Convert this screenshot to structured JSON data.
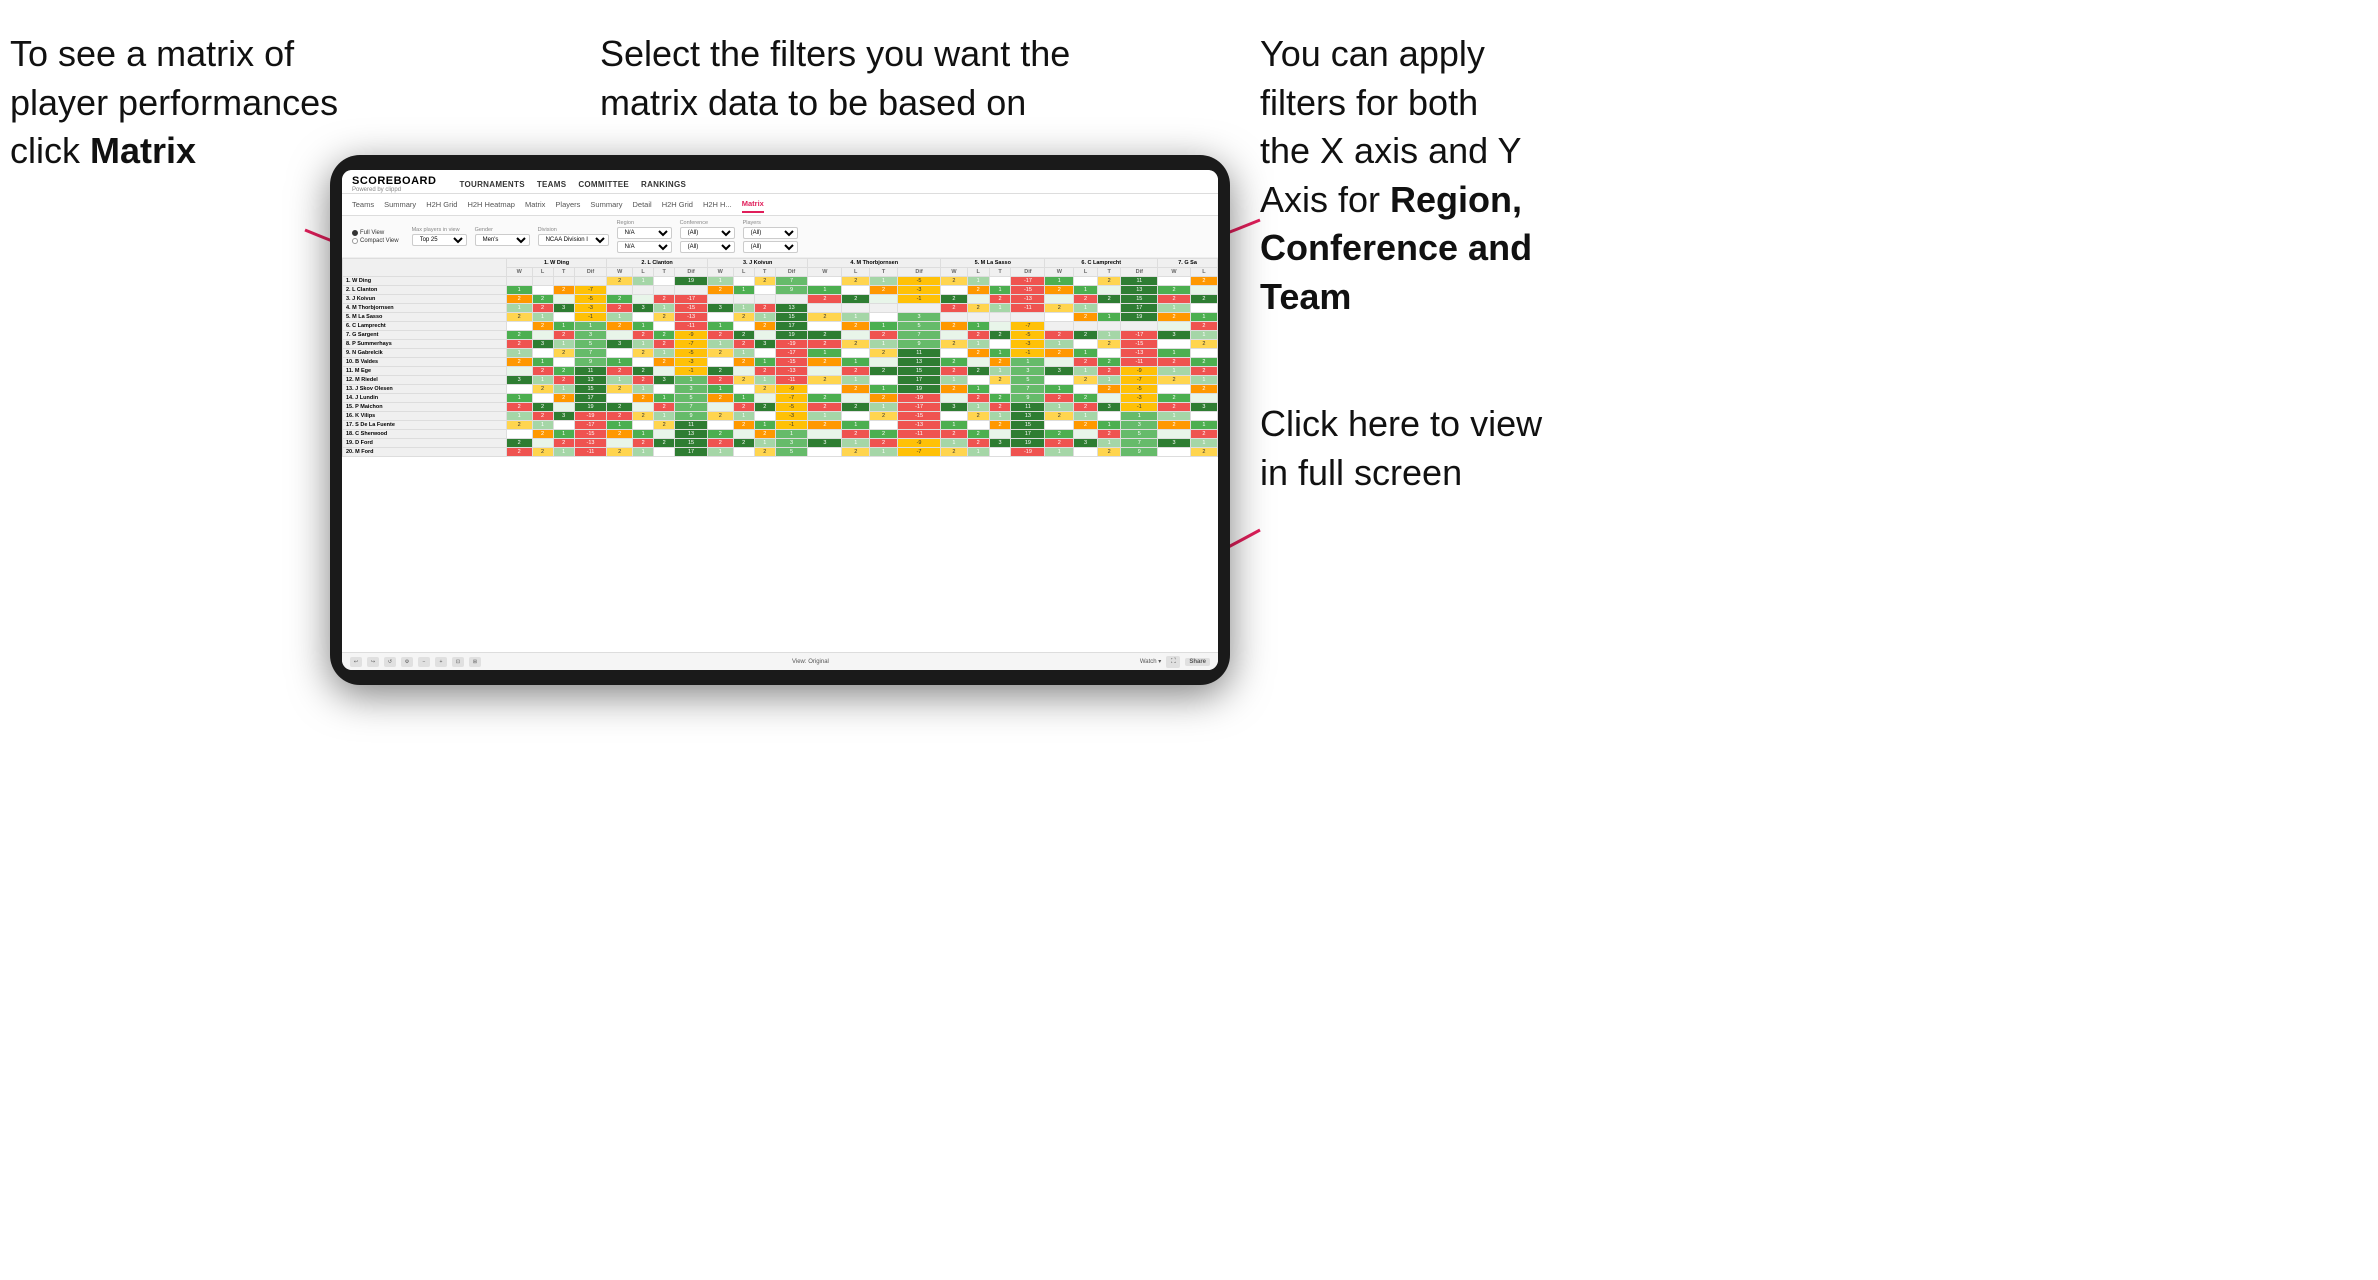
{
  "annotations": {
    "topleft": {
      "line1": "To see a matrix of",
      "line2": "player performances",
      "line3_prefix": "click ",
      "line3_bold": "Matrix"
    },
    "topcenter": {
      "text": "Select the filters you want the matrix data to be based on"
    },
    "topright": {
      "line1": "You  can apply",
      "line2": "filters for both",
      "line3": "the X axis and Y",
      "line4_prefix": "Axis for ",
      "line4_bold": "Region,",
      "line5_bold": "Conference and",
      "line6_bold": "Team"
    },
    "bottomright": {
      "line1": "Click here to view",
      "line2": "in full screen"
    }
  },
  "nav": {
    "logo_title": "SCOREBOARD",
    "logo_subtitle": "Powered by clippd",
    "items": [
      "TOURNAMENTS",
      "TEAMS",
      "COMMITTEE",
      "RANKINGS"
    ]
  },
  "subnav": {
    "items": [
      "Teams",
      "Summary",
      "H2H Grid",
      "H2H Heatmap",
      "Matrix",
      "Players",
      "Summary",
      "Detail",
      "H2H Grid",
      "H2H H...",
      "Matrix"
    ],
    "active_index": 10
  },
  "filters": {
    "view_options": [
      "Full View",
      "Compact View"
    ],
    "selected_view": "Full View",
    "max_players_label": "Max players in view",
    "max_players_value": "Top 25",
    "gender_label": "Gender",
    "gender_value": "Men's",
    "division_label": "Division",
    "division_value": "NCAA Division I",
    "region_label": "Region",
    "region_value1": "N/A",
    "region_value2": "N/A",
    "conference_label": "Conference",
    "conference_value1": "(All)",
    "conference_value2": "(All)",
    "players_label": "Players",
    "players_value1": "(All)",
    "players_value2": "(All)"
  },
  "column_headers": [
    "1. W Ding",
    "2. L Clanton",
    "3. J Koivun",
    "4. M Thorbjornsen",
    "5. M La Sasso",
    "6. C Lamprecht",
    "7. G Sa"
  ],
  "sub_headers": [
    "W",
    "L",
    "T",
    "Dif"
  ],
  "row_players": [
    "1. W Ding",
    "2. L Clanton",
    "3. J Koivun",
    "4. M Thorbjornsen",
    "5. M La Sasso",
    "6. C Lamprecht",
    "7. G Sargent",
    "8. P Summerhays",
    "9. N Gabrelcik",
    "10. B Valdes",
    "11. M Ege",
    "12. M Riedel",
    "13. J Skov Olesen",
    "14. J Lundin",
    "15. P Maichon",
    "16. K Vilips",
    "17. S De La Fuente",
    "18. C Sherwood",
    "19. D Ford",
    "20. M Ford"
  ],
  "toolbar": {
    "view_original": "View: Original",
    "watch_label": "Watch ▾",
    "share_label": "Share"
  },
  "colors": {
    "active_tab": "#e01e5a",
    "green_dark": "#1a7a1a",
    "green_med": "#4caf50",
    "yellow": "#ffc107",
    "orange": "#ff9800",
    "red": "#e53935"
  }
}
